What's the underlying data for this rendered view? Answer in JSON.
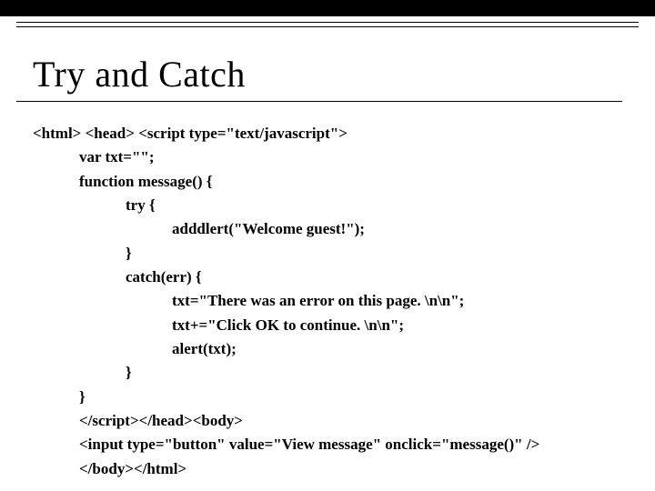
{
  "title": "Try and Catch",
  "code": {
    "l1": "<html> <head> <script type=\"text/javascript\">",
    "l2": "            var txt=\"\";",
    "l3": "            function message() {",
    "l4": "                        try {",
    "l5": "                                    adddlert(\"Welcome guest!\");",
    "l6": "                        }",
    "l7": "                        catch(err) {",
    "l8": "                                    txt=\"There was an error on this page. \\n\\n\";",
    "l9": "                                    txt+=\"Click OK to continue. \\n\\n\";",
    "l10": "                                    alert(txt);",
    "l11": "                        }",
    "l12": "            }",
    "l13": "            </script></head><body>",
    "l14": "            <input type=\"button\" value=\"View message\" onclick=\"message()\" />",
    "l15": "            </body></html>"
  }
}
